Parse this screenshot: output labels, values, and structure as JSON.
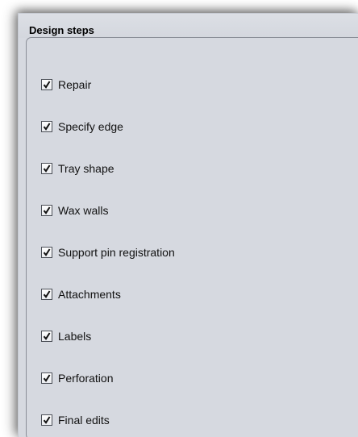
{
  "panel": {
    "title": "Design steps",
    "items": [
      {
        "label": "Repair",
        "checked": true
      },
      {
        "label": "Specify edge",
        "checked": true
      },
      {
        "label": "Tray shape",
        "checked": true
      },
      {
        "label": "Wax walls",
        "checked": true
      },
      {
        "label": "Support pin registration",
        "checked": true
      },
      {
        "label": "Attachments",
        "checked": true
      },
      {
        "label": "Labels",
        "checked": true
      },
      {
        "label": "Perforation",
        "checked": true
      },
      {
        "label": "Final edits",
        "checked": true
      }
    ]
  },
  "icons": {
    "checkmark": "check-icon"
  },
  "colors": {
    "panel_bg": "#d6d9e0",
    "border": "#8a8e97",
    "text": "#111111"
  }
}
